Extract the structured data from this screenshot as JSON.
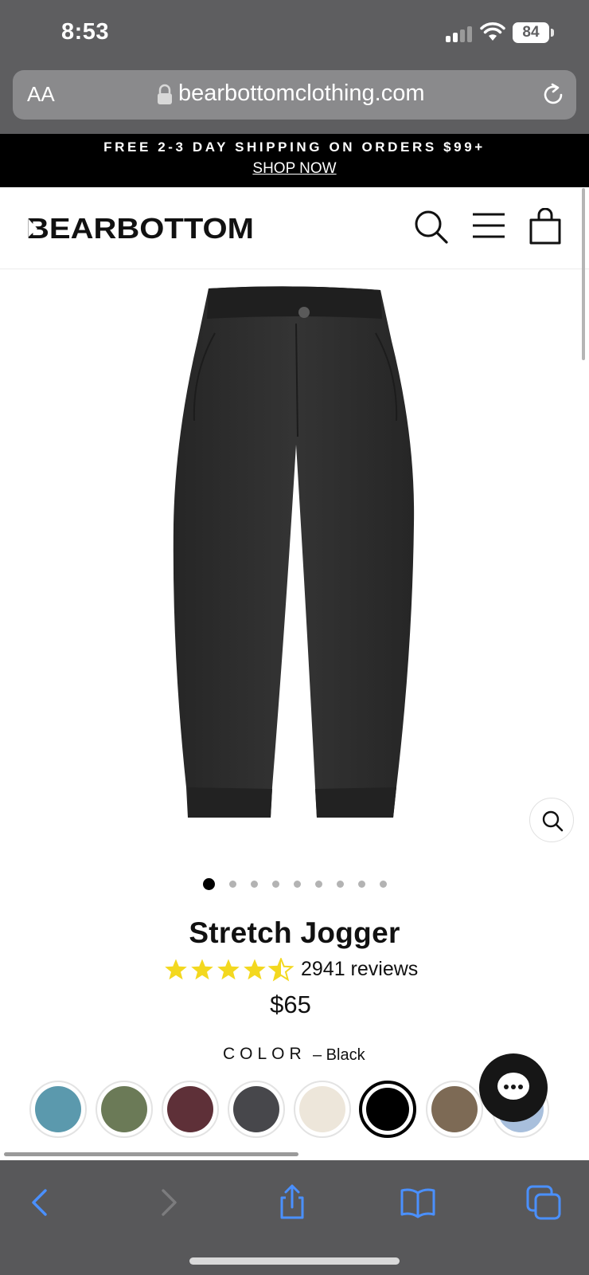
{
  "status_bar": {
    "time": "8:53",
    "battery": "84"
  },
  "browser": {
    "text_size_label": "AA",
    "url": "bearbottomclothing.com"
  },
  "promo": {
    "text": "FREE 2-3 DAY SHIPPING ON ORDERS $99+",
    "link": "SHOP NOW"
  },
  "header": {
    "logo": "BEARBOTTOM"
  },
  "product": {
    "title": "Stretch Jogger",
    "rating": 4.5,
    "rating_max": 5,
    "review_count": "2941 reviews",
    "price": "$65",
    "color_label": "COLOR",
    "selected_color": "– Black",
    "gallery_count": 9,
    "gallery_active_index": 0,
    "swatches": [
      {
        "name": "blue",
        "color": "#5b99ad"
      },
      {
        "name": "olive",
        "color": "#6b7a57"
      },
      {
        "name": "burgundy",
        "color": "#5e3038"
      },
      {
        "name": "charcoal",
        "color": "#47474b"
      },
      {
        "name": "cream",
        "color": "#ede6da"
      },
      {
        "name": "black",
        "color": "#000000",
        "selected": true
      },
      {
        "name": "khaki",
        "color": "#7d6a55"
      },
      {
        "name": "light-blue",
        "color": "#a8bfdc"
      }
    ]
  },
  "colors": {
    "accent_blue": "#4a90ff",
    "star_yellow": "#f3d81f",
    "status_bar_gray": "#5e5e60"
  }
}
